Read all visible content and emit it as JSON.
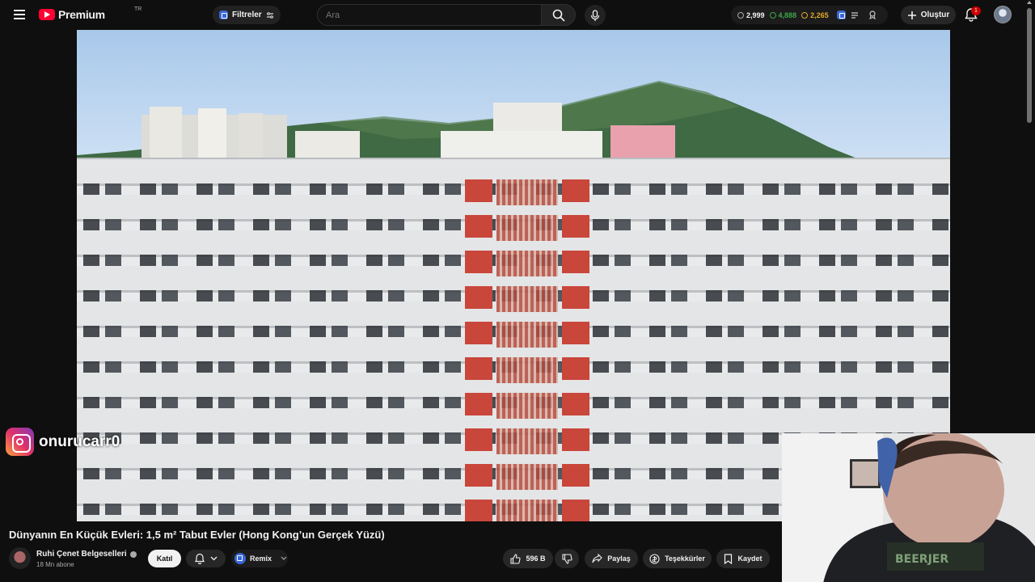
{
  "header": {
    "menu_icon": "hamburger-menu-icon",
    "logo_text": "Premium",
    "logo_region": "TR",
    "filters_label": "Filtreler",
    "search_placeholder": "Ara",
    "stats": {
      "views": "2,999",
      "likes": "4,888",
      "coins": "2,265"
    },
    "create_label": "Oluştur",
    "notification_count": "1"
  },
  "overlay": {
    "instagram_handle": "onurucarr0"
  },
  "video": {
    "title": "Dünyanın En Küçük Evleri: 1,5 m² Tabut Evler (Hong Kong’un Gerçek Yüzü)",
    "channel_name": "Ruhi Çenet Belgeselleri",
    "subscribers": "18 Mn abone",
    "join_label": "Katıl",
    "remix_label": "Remix",
    "actions": {
      "like_count": "596 B",
      "share_label": "Paylaş",
      "thanks_label": "Teşekkürler",
      "save_label": "Kaydet"
    }
  },
  "colors": {
    "background": "#0f0f0f",
    "brand_red": "#ff0033",
    "likes_green": "#3ea64a",
    "coins_gold": "#e0a92b"
  }
}
